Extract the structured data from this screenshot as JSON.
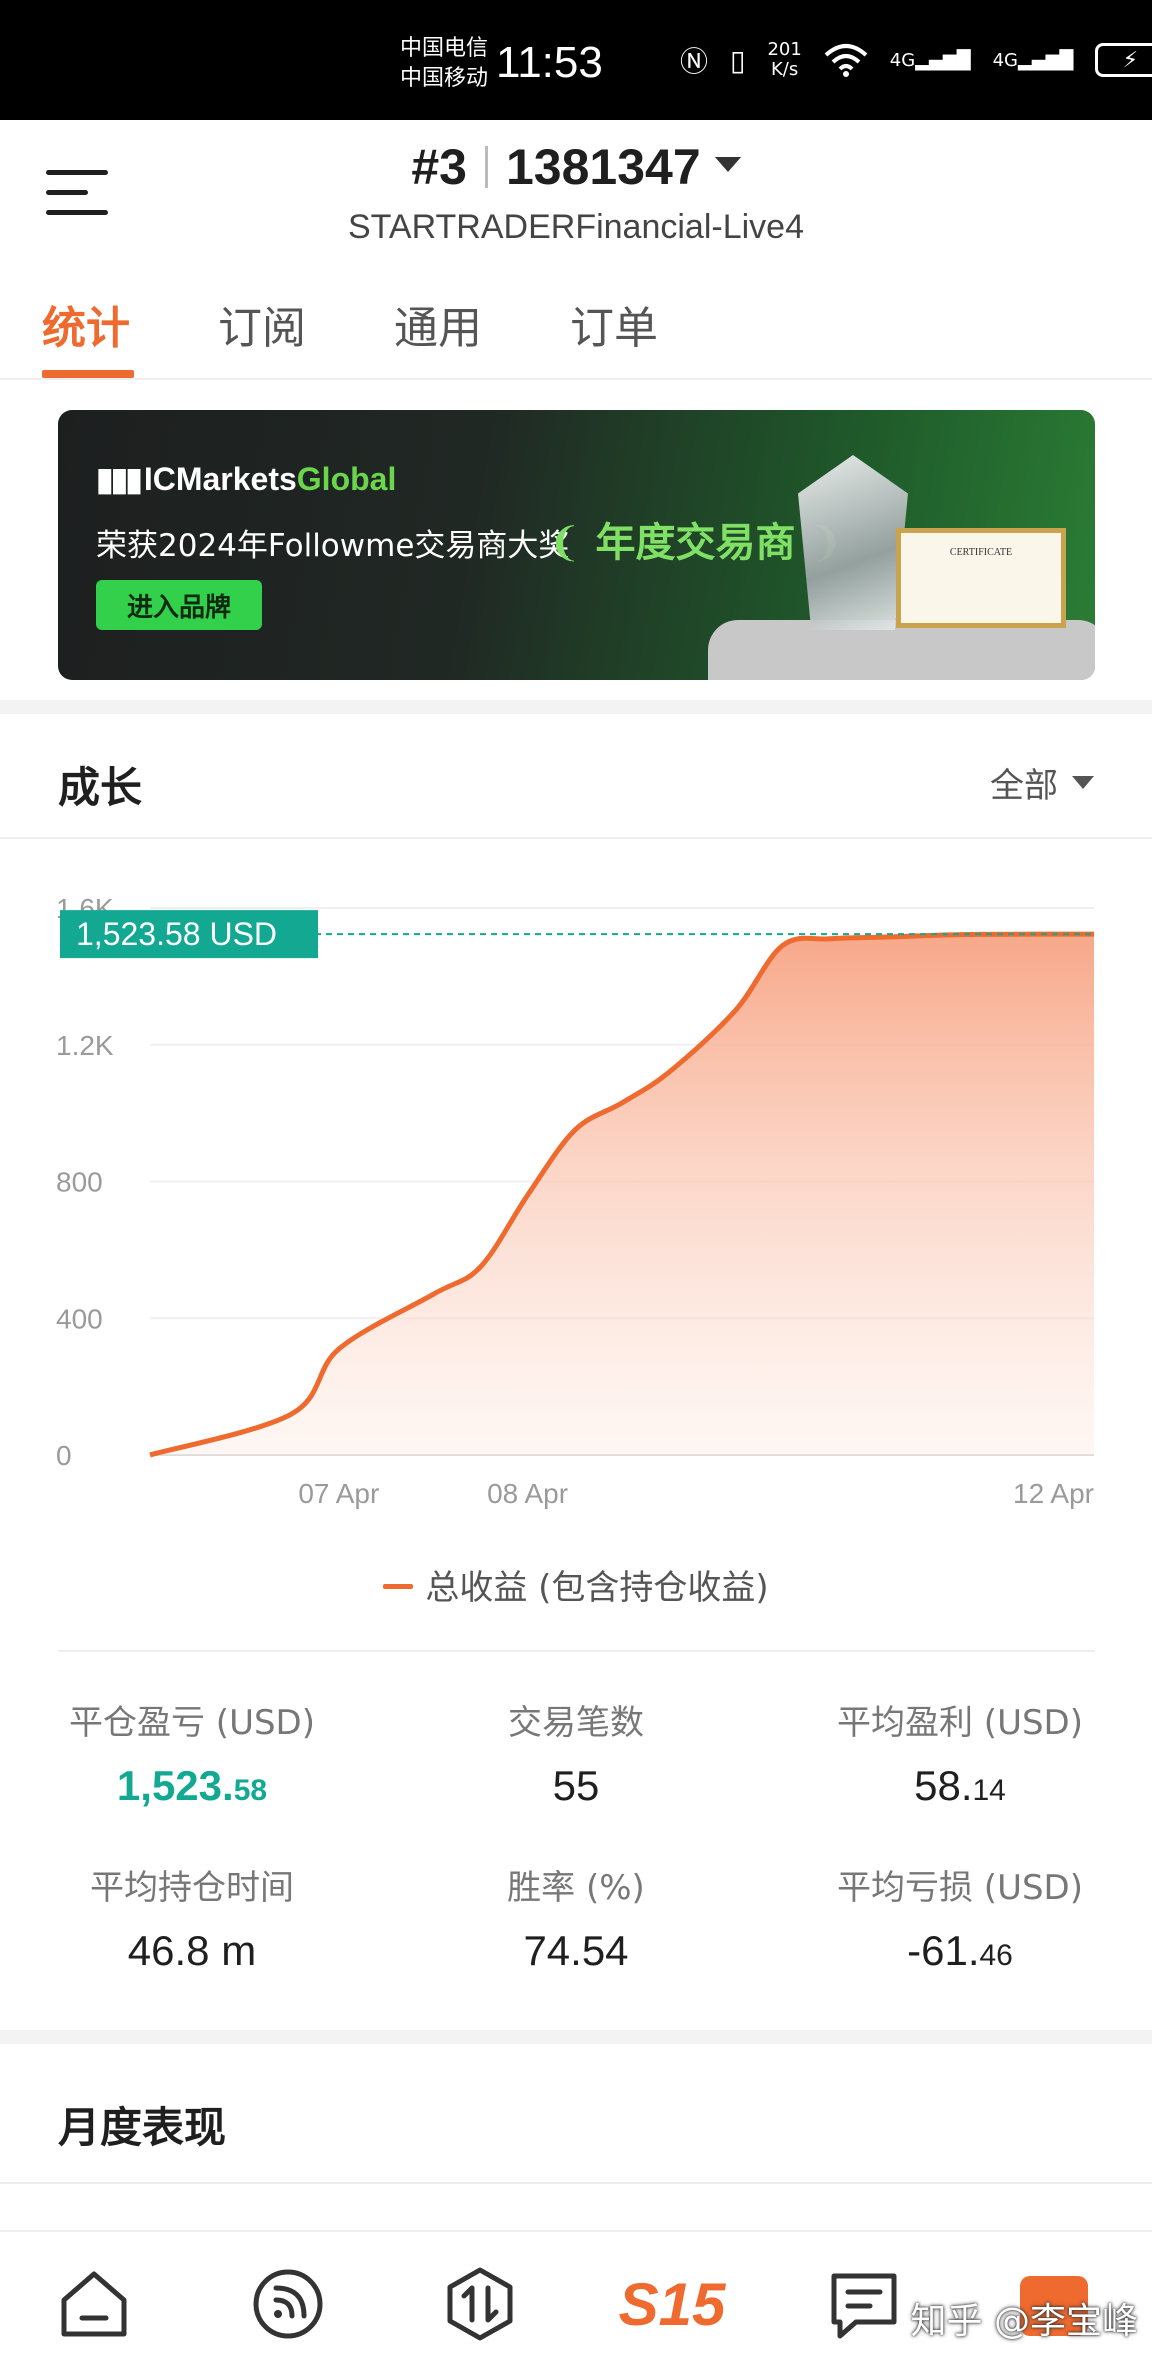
{
  "status_bar": {
    "carrier_1": "中国电信",
    "carrier_2": "中国移动",
    "time": "11:53",
    "speed_top": "201",
    "speed_bottom": "K/s",
    "net_1": "4G",
    "net_2": "4G"
  },
  "header": {
    "rank": "#3",
    "account": "1381347",
    "server": "STARTRADERFinancial-Live4"
  },
  "tabs": [
    {
      "label": "统计",
      "active": true
    },
    {
      "label": "订阅",
      "active": false
    },
    {
      "label": "通用",
      "active": false
    },
    {
      "label": "订单",
      "active": false
    }
  ],
  "banner": {
    "brand_prefix": "IC",
    "brand_main": "Markets",
    "brand_suffix": "Global",
    "award_text": "荣获2024年Followme交易商大奖",
    "award_title": "年度交易商",
    "button_label": "进入品牌",
    "certificate_text": "CERTIFICATE"
  },
  "growth": {
    "title": "成长",
    "range": "全部",
    "current_value_label": "1,523.58 USD",
    "legend": "总收益 (包含持仓收益)"
  },
  "chart_data": {
    "type": "area",
    "series": [
      {
        "name": "总收益 (包含持仓收益)",
        "color": "#ef6a2f",
        "x": [
          0,
          0.15,
          0.2,
          0.3,
          0.35,
          0.4,
          0.45,
          0.5,
          0.55,
          0.62,
          0.67,
          0.72,
          0.78,
          0.83,
          0.88,
          1.0
        ],
        "y": [
          0,
          120,
          310,
          470,
          550,
          760,
          950,
          1030,
          1120,
          1300,
          1490,
          1510,
          1515,
          1520,
          1523,
          1523.58
        ]
      }
    ],
    "x_ticks": [
      {
        "pos": 0.2,
        "label": "07 Apr"
      },
      {
        "pos": 0.4,
        "label": "08 Apr"
      },
      {
        "pos": 1.0,
        "label": "12 Apr"
      }
    ],
    "y_ticks": [
      0,
      400,
      800,
      1200,
      1600
    ],
    "y_tick_labels": [
      "0",
      "400",
      "800",
      "1.2K",
      "1.6K"
    ],
    "ylim": [
      0,
      1600
    ],
    "current_value": 1523.58,
    "grid": true
  },
  "stats": [
    {
      "label": "平仓盈亏 (USD)",
      "value_main": "1,523.",
      "value_small": "58",
      "green": true
    },
    {
      "label": "交易笔数",
      "value_main": "55",
      "value_small": "",
      "green": false
    },
    {
      "label": "平均盈利 (USD)",
      "value_main": "58.",
      "value_small": "14",
      "green": false
    },
    {
      "label": "平均持仓时间",
      "value_main": "46.8 m",
      "value_small": "",
      "green": false
    },
    {
      "label": "胜率 (%)",
      "value_main": "74.54",
      "value_small": "",
      "green": false
    },
    {
      "label": "平均亏损 (USD)",
      "value_main": "-61.",
      "value_small": "46",
      "green": false
    }
  ],
  "monthly": {
    "title": "月度表现"
  },
  "bottom_nav": {
    "center_label": "S15",
    "watermark": "知乎 @李宝峰",
    "icons": [
      "home-icon",
      "feed-icon",
      "trade-icon",
      "s15-logo",
      "message-icon",
      "profile-icon"
    ]
  }
}
